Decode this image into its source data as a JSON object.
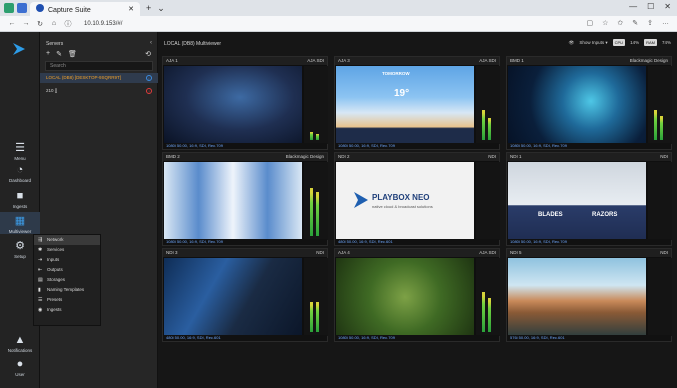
{
  "browser": {
    "tab_title": "Capture Suite",
    "url": "10.10.9.153/#/"
  },
  "leftnav": {
    "items": [
      {
        "label": "Menu",
        "icon": "hamburger-icon"
      },
      {
        "label": "Dashboard",
        "icon": "gauge-icon"
      },
      {
        "label": "Ingests",
        "icon": "camera-icon"
      },
      {
        "label": "Multiviewer",
        "icon": "grid-icon"
      },
      {
        "label": "Setup",
        "icon": "gear-icon"
      },
      {
        "label": "Notifications",
        "icon": "bell-icon"
      },
      {
        "label": "User",
        "icon": "user-icon"
      }
    ]
  },
  "servers": {
    "title": "Servers",
    "search_placeholder": "Search",
    "rows": [
      {
        "name": "LOCAL (DB8) [DESKTOP-9SQRR9T]",
        "status": "i"
      },
      {
        "name": "210 []",
        "status": "!"
      }
    ]
  },
  "setup_menu": {
    "items": [
      "Network",
      "Services",
      "Inputs",
      "Outputs",
      "Storages",
      "Naming Templates",
      "Presets",
      "Ingests"
    ]
  },
  "main": {
    "title": "LOCAL (DB8) Multiviewer",
    "show_inputs": "Show Inputs",
    "cpu_label": "CPU",
    "cpu_value": "14%",
    "ram_label": "RAM",
    "ram_value": "74%"
  },
  "tiles": [
    {
      "name": "AJA 1",
      "type": "AJA SDI",
      "foot": "1080i 50.00, 16:9, SDI, Rec.709"
    },
    {
      "name": "AJA 3",
      "type": "AJA SDI",
      "foot": "1080i 50.00, 16:9, SDI, Rec.709"
    },
    {
      "name": "BMD 1",
      "type": "Blackmagic Design",
      "foot": "1080i 50.00, 16:9, SDI, Rec.709"
    },
    {
      "name": "BMD 2",
      "type": "Blackmagic Design",
      "foot": "1080i 50.00, 16:9, SDI, Rec.709"
    },
    {
      "name": "NDI 2",
      "type": "NDI",
      "foot": "480i 50.00, 16:9, SDI, Rec.601"
    },
    {
      "name": "NDI 1",
      "type": "NDI",
      "foot": "1080i 50.00, 16:9, SDI, Rec.709"
    },
    {
      "name": "NDI 3",
      "type": "NDI",
      "foot": "480i 50.00, 16:9, SDI, Rec.601"
    },
    {
      "name": "AJA 4",
      "type": "AJA SDI",
      "foot": "1080i 50.00, 16:9, SDI, Rec.709"
    },
    {
      "name": "NDI 5",
      "type": "NDI",
      "foot": "576i 50.00, 16:9, SDI, Rec.601"
    }
  ],
  "overlays": {
    "weather_title": "TOMORROW",
    "weather_temp": "19°",
    "playbox_logo": "PLAYBOX NEO",
    "playbox_sub": "native cloud & broadcast solutions",
    "hockey_left": "BLADES",
    "hockey_right": "RAZORS"
  }
}
